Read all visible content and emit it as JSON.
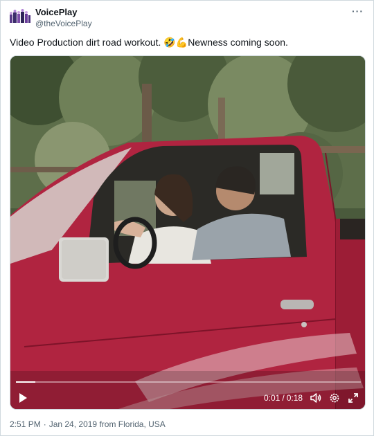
{
  "author": {
    "display_name": "VoicePlay",
    "handle": "@theVoicePlay",
    "avatar_icon": "group-avatar-icon"
  },
  "menu": {
    "more_label": "···"
  },
  "tweet": {
    "text_before": "Video Production dirt road workout. ",
    "emoji": "🤣💪",
    "text_after": "Newness coming soon."
  },
  "video": {
    "current_time": "0:01",
    "separator": "/",
    "duration": "0:18",
    "progress_fraction": 0.056,
    "icons": [
      "play-icon",
      "volume-icon",
      "settings-icon",
      "fullscreen-icon"
    ]
  },
  "footer": {
    "time": "2:51 PM",
    "dot": "·",
    "date": "Jan 24, 2019",
    "location": "from Florida, USA"
  },
  "colors": {
    "text": "#0f1419",
    "muted": "#536471",
    "border": "#cfd9de",
    "truck_red": "#a8213a"
  }
}
